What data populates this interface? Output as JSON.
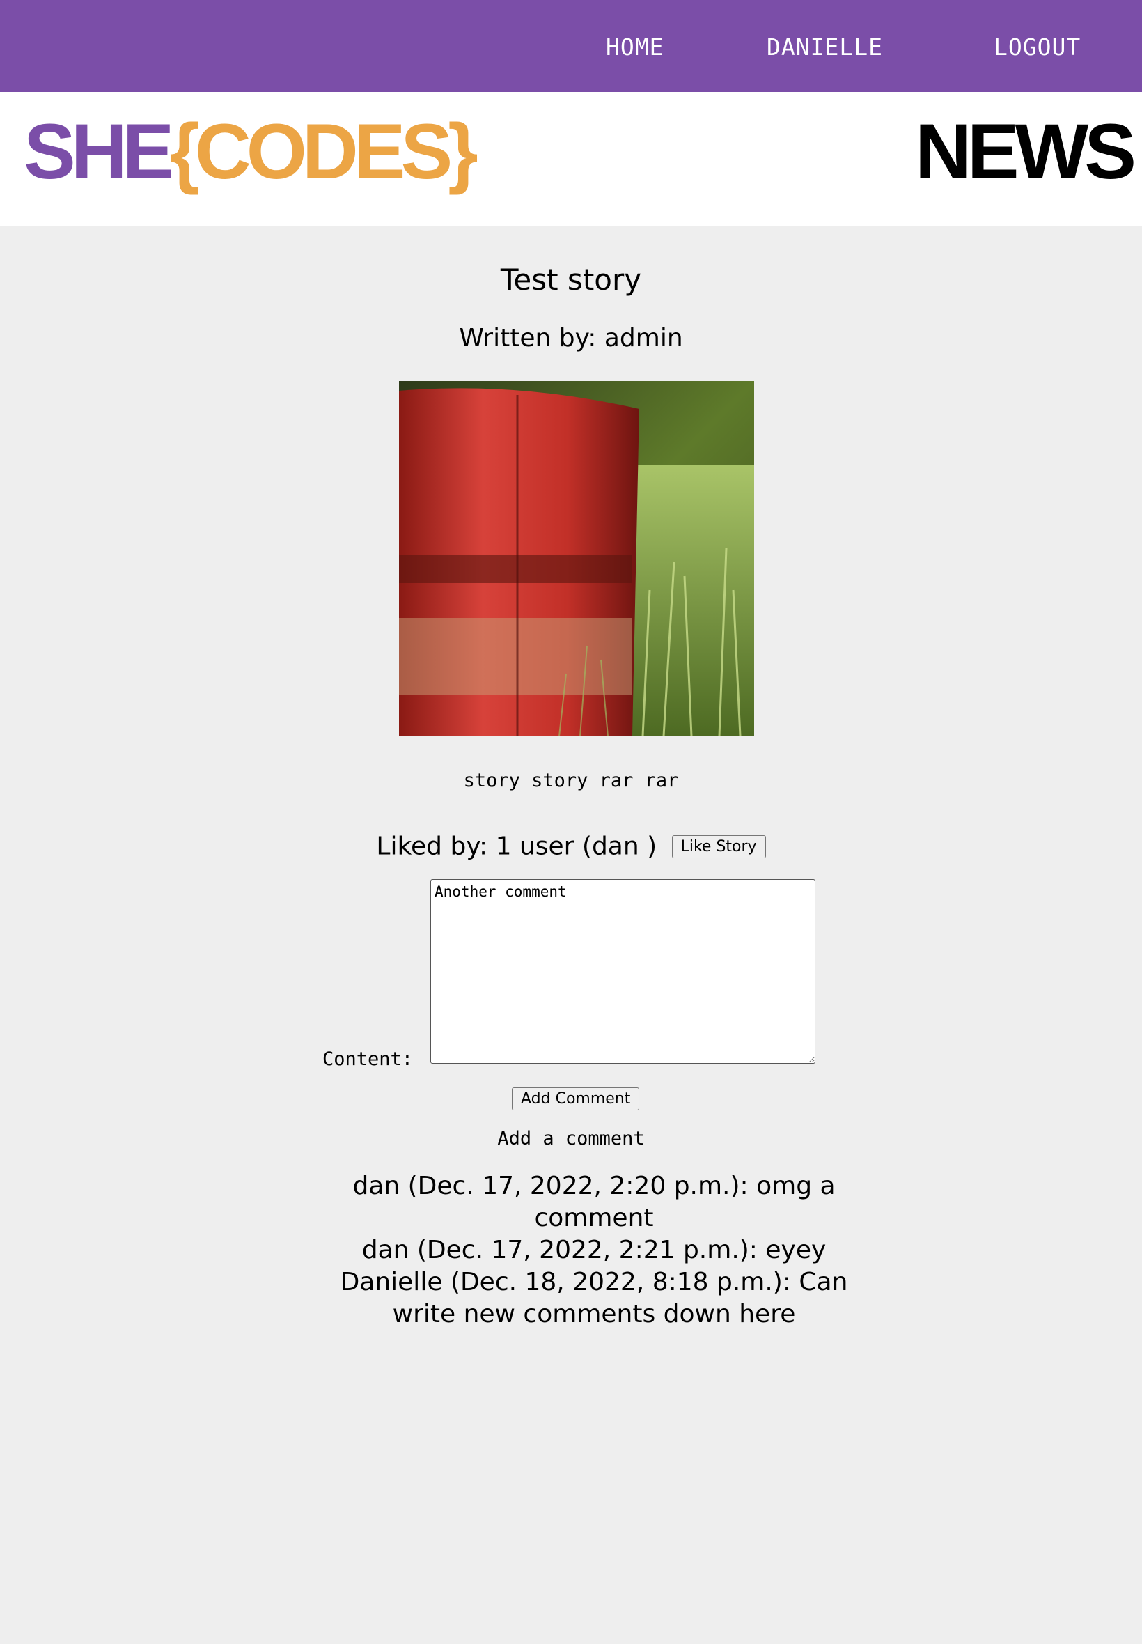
{
  "nav": {
    "home": "HOME",
    "user": "DANIELLE",
    "logout": "LOGOUT"
  },
  "brand": {
    "she": "SHE",
    "codes": "{CODES}",
    "news": "NEWS",
    "colors": {
      "purple": "#7b4ea8",
      "orange": "#eca545"
    }
  },
  "story": {
    "title": "Test story",
    "author": "Written by: admin",
    "image_icon": "red-rusty-barrel-photo",
    "body": "story story rar rar",
    "likes": "Liked by: 1 user (dan )",
    "like_button": "Like Story"
  },
  "comment_form": {
    "label": "Content:",
    "value": "Another comment",
    "submit": "Add Comment",
    "heading": "Add a comment"
  },
  "comments": [
    "dan (Dec. 17, 2022, 2:20 p.m.): omg a comment",
    "dan (Dec. 17, 2022, 2:21 p.m.): eyey",
    "Danielle (Dec. 18, 2022, 8:18 p.m.): Can write new comments down here"
  ]
}
